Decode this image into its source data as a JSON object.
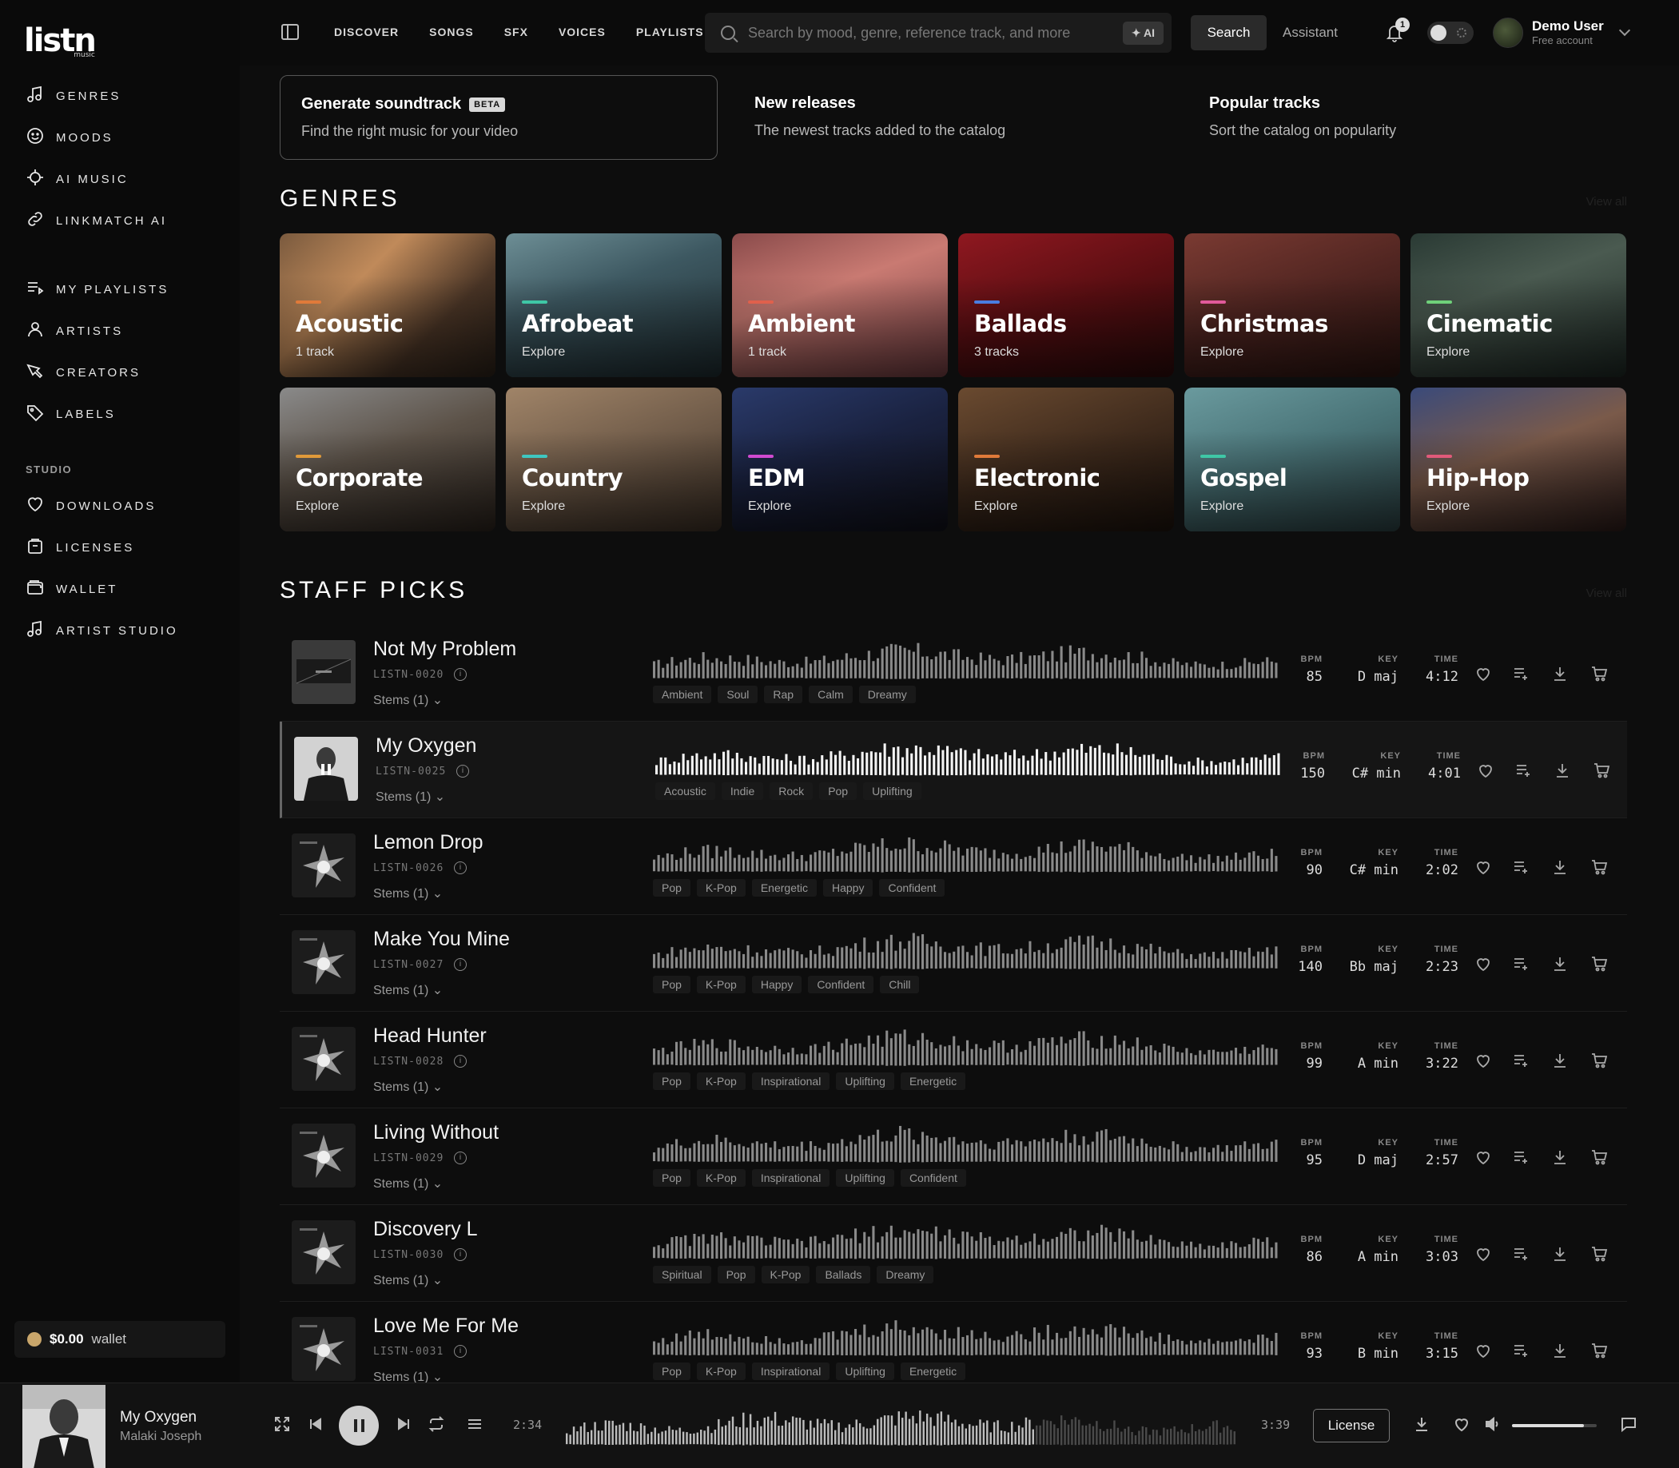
{
  "brand": {
    "logo": "listn",
    "logo_sub": "music"
  },
  "sidebar": {
    "primary": [
      {
        "label": "GENRES",
        "icon": "music-note-icon"
      },
      {
        "label": "MOODS",
        "icon": "smiley-icon"
      },
      {
        "label": "AI MUSIC",
        "icon": "ai-spark-icon"
      },
      {
        "label": "LINKMATCH AI",
        "icon": "link-icon"
      }
    ],
    "secondary": [
      {
        "label": "MY PLAYLISTS",
        "icon": "playlist-icon"
      },
      {
        "label": "ARTISTS",
        "icon": "user-icon"
      },
      {
        "label": "CREATORS",
        "icon": "tag-pen-icon"
      },
      {
        "label": "LABELS",
        "icon": "label-tag-icon"
      }
    ],
    "studio_label": "STUDIO",
    "studio": [
      {
        "label": "DOWNLOADS",
        "icon": "heart-icon"
      },
      {
        "label": "LICENSES",
        "icon": "license-bag-icon"
      },
      {
        "label": "WALLET",
        "icon": "wallet-icon"
      },
      {
        "label": "ARTIST STUDIO",
        "icon": "music-note-icon"
      }
    ],
    "wallet": {
      "amount": "$0.00",
      "label": "wallet"
    }
  },
  "topbar": {
    "nav": [
      "DISCOVER",
      "SONGS",
      "SFX",
      "VOICES",
      "PLAYLISTS"
    ],
    "search_placeholder": "Search by mood, genre, reference track, and more",
    "ai_chip": "✦ AI",
    "search_button": "Search",
    "assistant": "Assistant",
    "notifications": "1",
    "user": {
      "name": "Demo User",
      "account": "Free account"
    }
  },
  "features": [
    {
      "title": "Generate soundtrack",
      "badge": "BETA",
      "subtitle": "Find the right music for your video"
    },
    {
      "title": "New releases",
      "subtitle": "The newest tracks added to the catalog"
    },
    {
      "title": "Popular tracks",
      "subtitle": "Sort the catalog on popularity"
    }
  ],
  "genres": {
    "title": "GENRES",
    "view_all": "View all",
    "items": [
      {
        "name": "Acoustic",
        "sub": "1 track",
        "accent": "#e07a3a",
        "bg": "linear-gradient(135deg,#7a5a3e 0%,#c08a5a 35%,#4a3526 70%,#2a2018 100%)"
      },
      {
        "name": "Afrobeat",
        "sub": "Explore",
        "accent": "#3fc7a6",
        "bg": "linear-gradient(160deg,#6d8e95 0%,#3d5861 40%,#1d2a2e 100%)"
      },
      {
        "name": "Ambient",
        "sub": "1 track",
        "accent": "#e0604c",
        "bg": "linear-gradient(160deg,#8a4b4b 0%,#c97a72 40%,#6c3a3e 100%)"
      },
      {
        "name": "Ballads",
        "sub": "3 tracks",
        "accent": "#4a7de0",
        "bg": "linear-gradient(160deg,#8f1820 0%,#5a0e12 50%,#2a0a0a 100%)"
      },
      {
        "name": "Christmas",
        "sub": "Explore",
        "accent": "#e05a9a",
        "bg": "linear-gradient(160deg,#7a3a32 0%,#4e2420 50%,#2a1410 100%)"
      },
      {
        "name": "Cinematic",
        "sub": "Explore",
        "accent": "#6fd07a",
        "bg": "linear-gradient(160deg,#2a3a34 0%,#4a5a50 40%,#1c2622 100%)"
      },
      {
        "name": "Corporate",
        "sub": "Explore",
        "accent": "#e09a3a",
        "bg": "linear-gradient(160deg,#8a8a8a 0%,#5c5248 45%,#2a221c 100%)"
      },
      {
        "name": "Country",
        "sub": "Explore",
        "accent": "#3fc7c0",
        "bg": "linear-gradient(160deg,#a08468 0%,#6e5a48 50%,#3a2e24 100%)"
      },
      {
        "name": "EDM",
        "sub": "Explore",
        "accent": "#d04ad0",
        "bg": "linear-gradient(160deg,#2a3a6a 0%,#1a2240 45%,#101018 100%)"
      },
      {
        "name": "Electronic",
        "sub": "Explore",
        "accent": "#e07a3a",
        "bg": "linear-gradient(160deg,#6a4a30 0%,#3e2a1c 50%,#1c120c 100%)"
      },
      {
        "name": "Gospel",
        "sub": "Explore",
        "accent": "#3fc7a6",
        "bg": "linear-gradient(160deg,#6a9a9e 0%,#4a7478 45%,#2a3e40 100%)"
      },
      {
        "name": "Hip-Hop",
        "sub": "Explore",
        "accent": "#e05a7a",
        "bg": "linear-gradient(160deg,#3a4a7a 0%,#7a5a4a 45%,#2a1a18 100%)"
      }
    ]
  },
  "staff_picks": {
    "title": "STAFF PICKS",
    "view_all": "View all",
    "labels": {
      "bpm": "BPM",
      "key": "KEY",
      "time": "TIME"
    },
    "tracks": [
      {
        "title": "Not My Problem",
        "code": "LISTN-0020",
        "stems": "Stems (1)",
        "tags": [
          "Ambient",
          "Soul",
          "Rap",
          "Calm",
          "Dreamy"
        ],
        "bpm": "85",
        "key": "D maj",
        "time": "4:12",
        "active": false
      },
      {
        "title": "My Oxygen",
        "code": "LISTN-0025",
        "stems": "Stems (1)",
        "tags": [
          "Acoustic",
          "Indie",
          "Rock",
          "Pop",
          "Uplifting"
        ],
        "bpm": "150",
        "key": "C# min",
        "time": "4:01",
        "active": true
      },
      {
        "title": "Lemon Drop",
        "code": "LISTN-0026",
        "stems": "Stems (1)",
        "tags": [
          "Pop",
          "K-Pop",
          "Energetic",
          "Happy",
          "Confident"
        ],
        "bpm": "90",
        "key": "C# min",
        "time": "2:02",
        "active": false
      },
      {
        "title": "Make You Mine",
        "code": "LISTN-0027",
        "stems": "Stems (1)",
        "tags": [
          "Pop",
          "K-Pop",
          "Happy",
          "Confident",
          "Chill"
        ],
        "bpm": "140",
        "key": "Bb maj",
        "time": "2:23",
        "active": false
      },
      {
        "title": "Head Hunter",
        "code": "LISTN-0028",
        "stems": "Stems (1)",
        "tags": [
          "Pop",
          "K-Pop",
          "Inspirational",
          "Uplifting",
          "Energetic"
        ],
        "bpm": "99",
        "key": "A min",
        "time": "3:22",
        "active": false
      },
      {
        "title": "Living Without",
        "code": "LISTN-0029",
        "stems": "Stems (1)",
        "tags": [
          "Pop",
          "K-Pop",
          "Inspirational",
          "Uplifting",
          "Confident"
        ],
        "bpm": "95",
        "key": "D maj",
        "time": "2:57",
        "active": false
      },
      {
        "title": "Discovery L",
        "code": "LISTN-0030",
        "stems": "Stems (1)",
        "tags": [
          "Spiritual",
          "Pop",
          "K-Pop",
          "Ballads",
          "Dreamy"
        ],
        "bpm": "86",
        "key": "A min",
        "time": "3:03",
        "active": false
      },
      {
        "title": "Love Me For Me",
        "code": "LISTN-0031",
        "stems": "Stems (1)",
        "tags": [
          "Pop",
          "K-Pop",
          "Inspirational",
          "Uplifting",
          "Energetic"
        ],
        "bpm": "93",
        "key": "B min",
        "time": "3:15",
        "active": false
      }
    ]
  },
  "player": {
    "title": "My Oxygen",
    "artist": "Malaki Joseph",
    "elapsed": "2:34",
    "duration": "3:39",
    "progress": 0.7,
    "volume": 0.85,
    "license": "License"
  }
}
